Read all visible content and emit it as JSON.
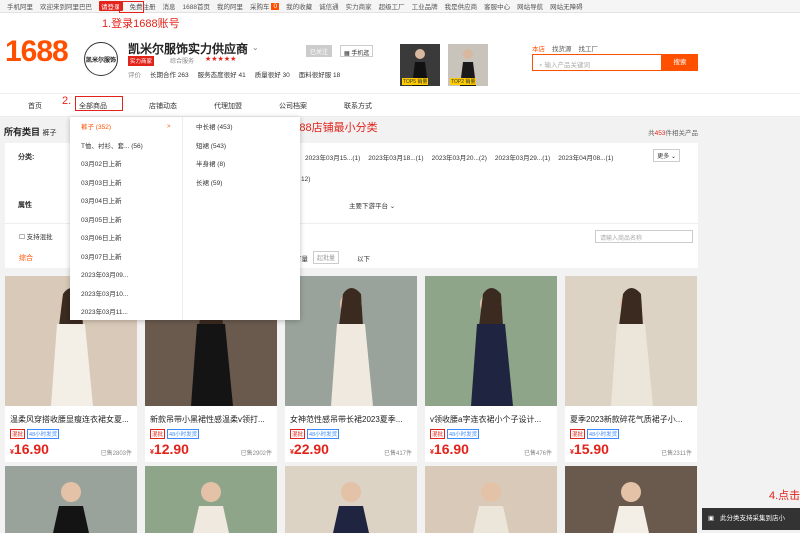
{
  "topbar": {
    "items": [
      "手机阿里",
      "欢迎来到阿里巴巴",
      "请登录",
      "免费注册",
      "消息",
      "1688首页",
      "我的阿里",
      "采购车",
      "0",
      "我的收藏",
      "诚信通",
      "实力商家",
      "超级工厂",
      "工业品牌",
      "我是供应商",
      "客服中心",
      "网站导航",
      "网站无障碍"
    ]
  },
  "logo": "1688",
  "shop": {
    "name": "凯米尔服饰实力供应商",
    "avatar": "凯米尔服饰",
    "badge": "实力商家",
    "rating_label": "综合服务",
    "stars": "★★★★★",
    "follow": "已关注",
    "phone": "手机逛",
    "stats": [
      "评价",
      "长期合作 263",
      "服务态度很好 41",
      "质量很好 30",
      "面料很好服 18"
    ]
  },
  "thumbs": [
    "TOP5 销量",
    "TOP2 销量"
  ],
  "search": {
    "tabs": [
      "本店",
      "找货源",
      "找工厂"
    ],
    "placeholder": "输入产品关键词",
    "button": "搜索"
  },
  "nav": [
    "首页",
    "全部商品",
    "店铺动态",
    "代理加盟",
    "公司档案",
    "联系方式"
  ],
  "annotations": [
    "1.登录1688账号",
    "2.",
    "3.选择1688店铺最小分类",
    "4.点击"
  ],
  "category": {
    "title": "所有类目",
    "crumb": "裤子",
    "count_prefix": "共",
    "count": "453",
    "count_suffix": "件相关产品"
  },
  "panel": {
    "label_cat": "分类:",
    "label_attr": "属性",
    "dates": [
      "2023年03月15...(1)",
      "2023年03月18...(1)",
      "2023年03月20...(2)",
      "2023年03月29...(1)",
      "2023年04月08...(1)"
    ],
    "row2": "12)",
    "more": "更多",
    "platform": "主要下游平台"
  },
  "filter": {
    "checkbox": "支持混批",
    "sort": "综合",
    "order": "订量",
    "price": "起批量",
    "below": "以下",
    "search_placeholder": "请输入商品名称"
  },
  "dropdown": {
    "items": [
      {
        "left": "裤子 (352)",
        "right": "中长裙 (453)"
      },
      {
        "left": "T恤、衬衫、套... (56)",
        "right": "短裙 (543)"
      },
      {
        "left": "03月02日上新",
        "right": "半身裙 (8)"
      },
      {
        "left": "03月03日上新",
        "right": "长裙 (59)"
      },
      {
        "left": "03月04日上新"
      },
      {
        "left": "03月05日上新"
      },
      {
        "left": "03月06日上新"
      },
      {
        "left": "03月07日上新"
      },
      {
        "left": "2023年03月09..."
      },
      {
        "left": "2023年03月10..."
      },
      {
        "left": "2023年03月11..."
      }
    ]
  },
  "products": [
    {
      "title": "温柔风穿搭收腰显瘦连衣裙女夏...",
      "price": "16.90",
      "sold": "已售2803件"
    },
    {
      "title": "新款吊带小黑裙性感温柔v领打...",
      "price": "12.90",
      "sold": "已售2902件"
    },
    {
      "title": "女神范性感吊带长裙2023夏季...",
      "price": "22.90",
      "sold": "已售417件"
    },
    {
      "title": "v领收腰a字连衣裙小个子设计...",
      "price": "16.90",
      "sold": "已售476件"
    },
    {
      "title": "夏季2023新款碎花气质裙子小...",
      "price": "15.90",
      "sold": "已售2311件"
    }
  ],
  "tags": [
    "混批",
    "48小时发货"
  ],
  "currency": "¥",
  "bottombar": "此分类支持采集到店小"
}
